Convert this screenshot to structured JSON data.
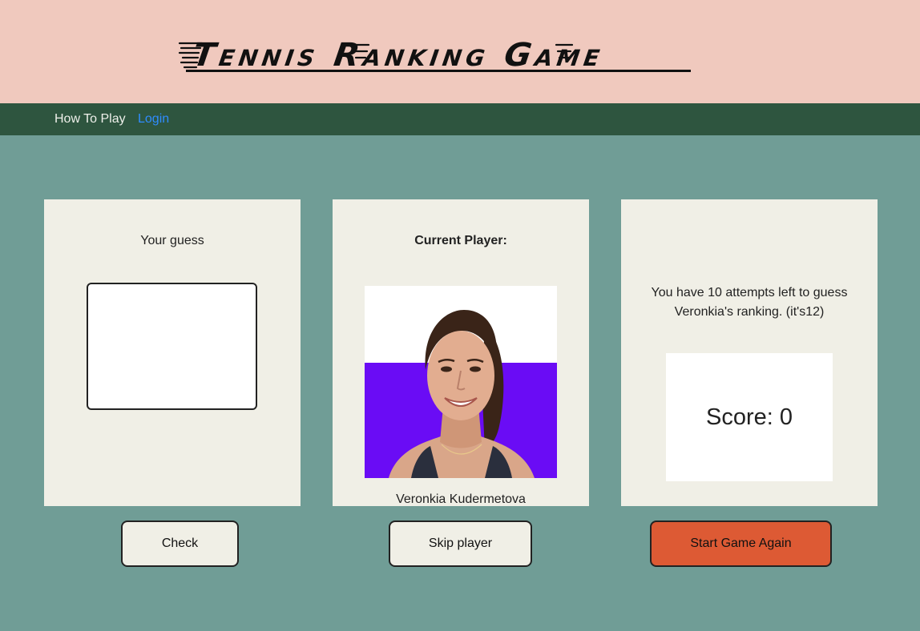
{
  "header": {
    "title": "Tennis Ranking Game"
  },
  "nav": {
    "how_to_play": "How To Play",
    "login": "Login"
  },
  "guess_panel": {
    "label": "Your guess",
    "input_value": "",
    "check_button": "Check"
  },
  "player_panel": {
    "label": "Current Player:",
    "photo_icon": "player-portrait",
    "name": "Veronkia Kudermetova",
    "skip_button": "Skip player"
  },
  "status_panel": {
    "attempts_message": "You have 10 attempts left to guess Veronkia's ranking. (it's12)",
    "score": "Score: 0",
    "restart_button": "Start Game Again"
  },
  "colors": {
    "page_background": "#709d96",
    "header_background": "#f0c9be",
    "nav_background": "#2e553f",
    "card_background": "#f0efe6",
    "login_link": "#2f8cff",
    "restart_button": "#dd5a34",
    "photo_background_purple": "#6a0cf5"
  }
}
